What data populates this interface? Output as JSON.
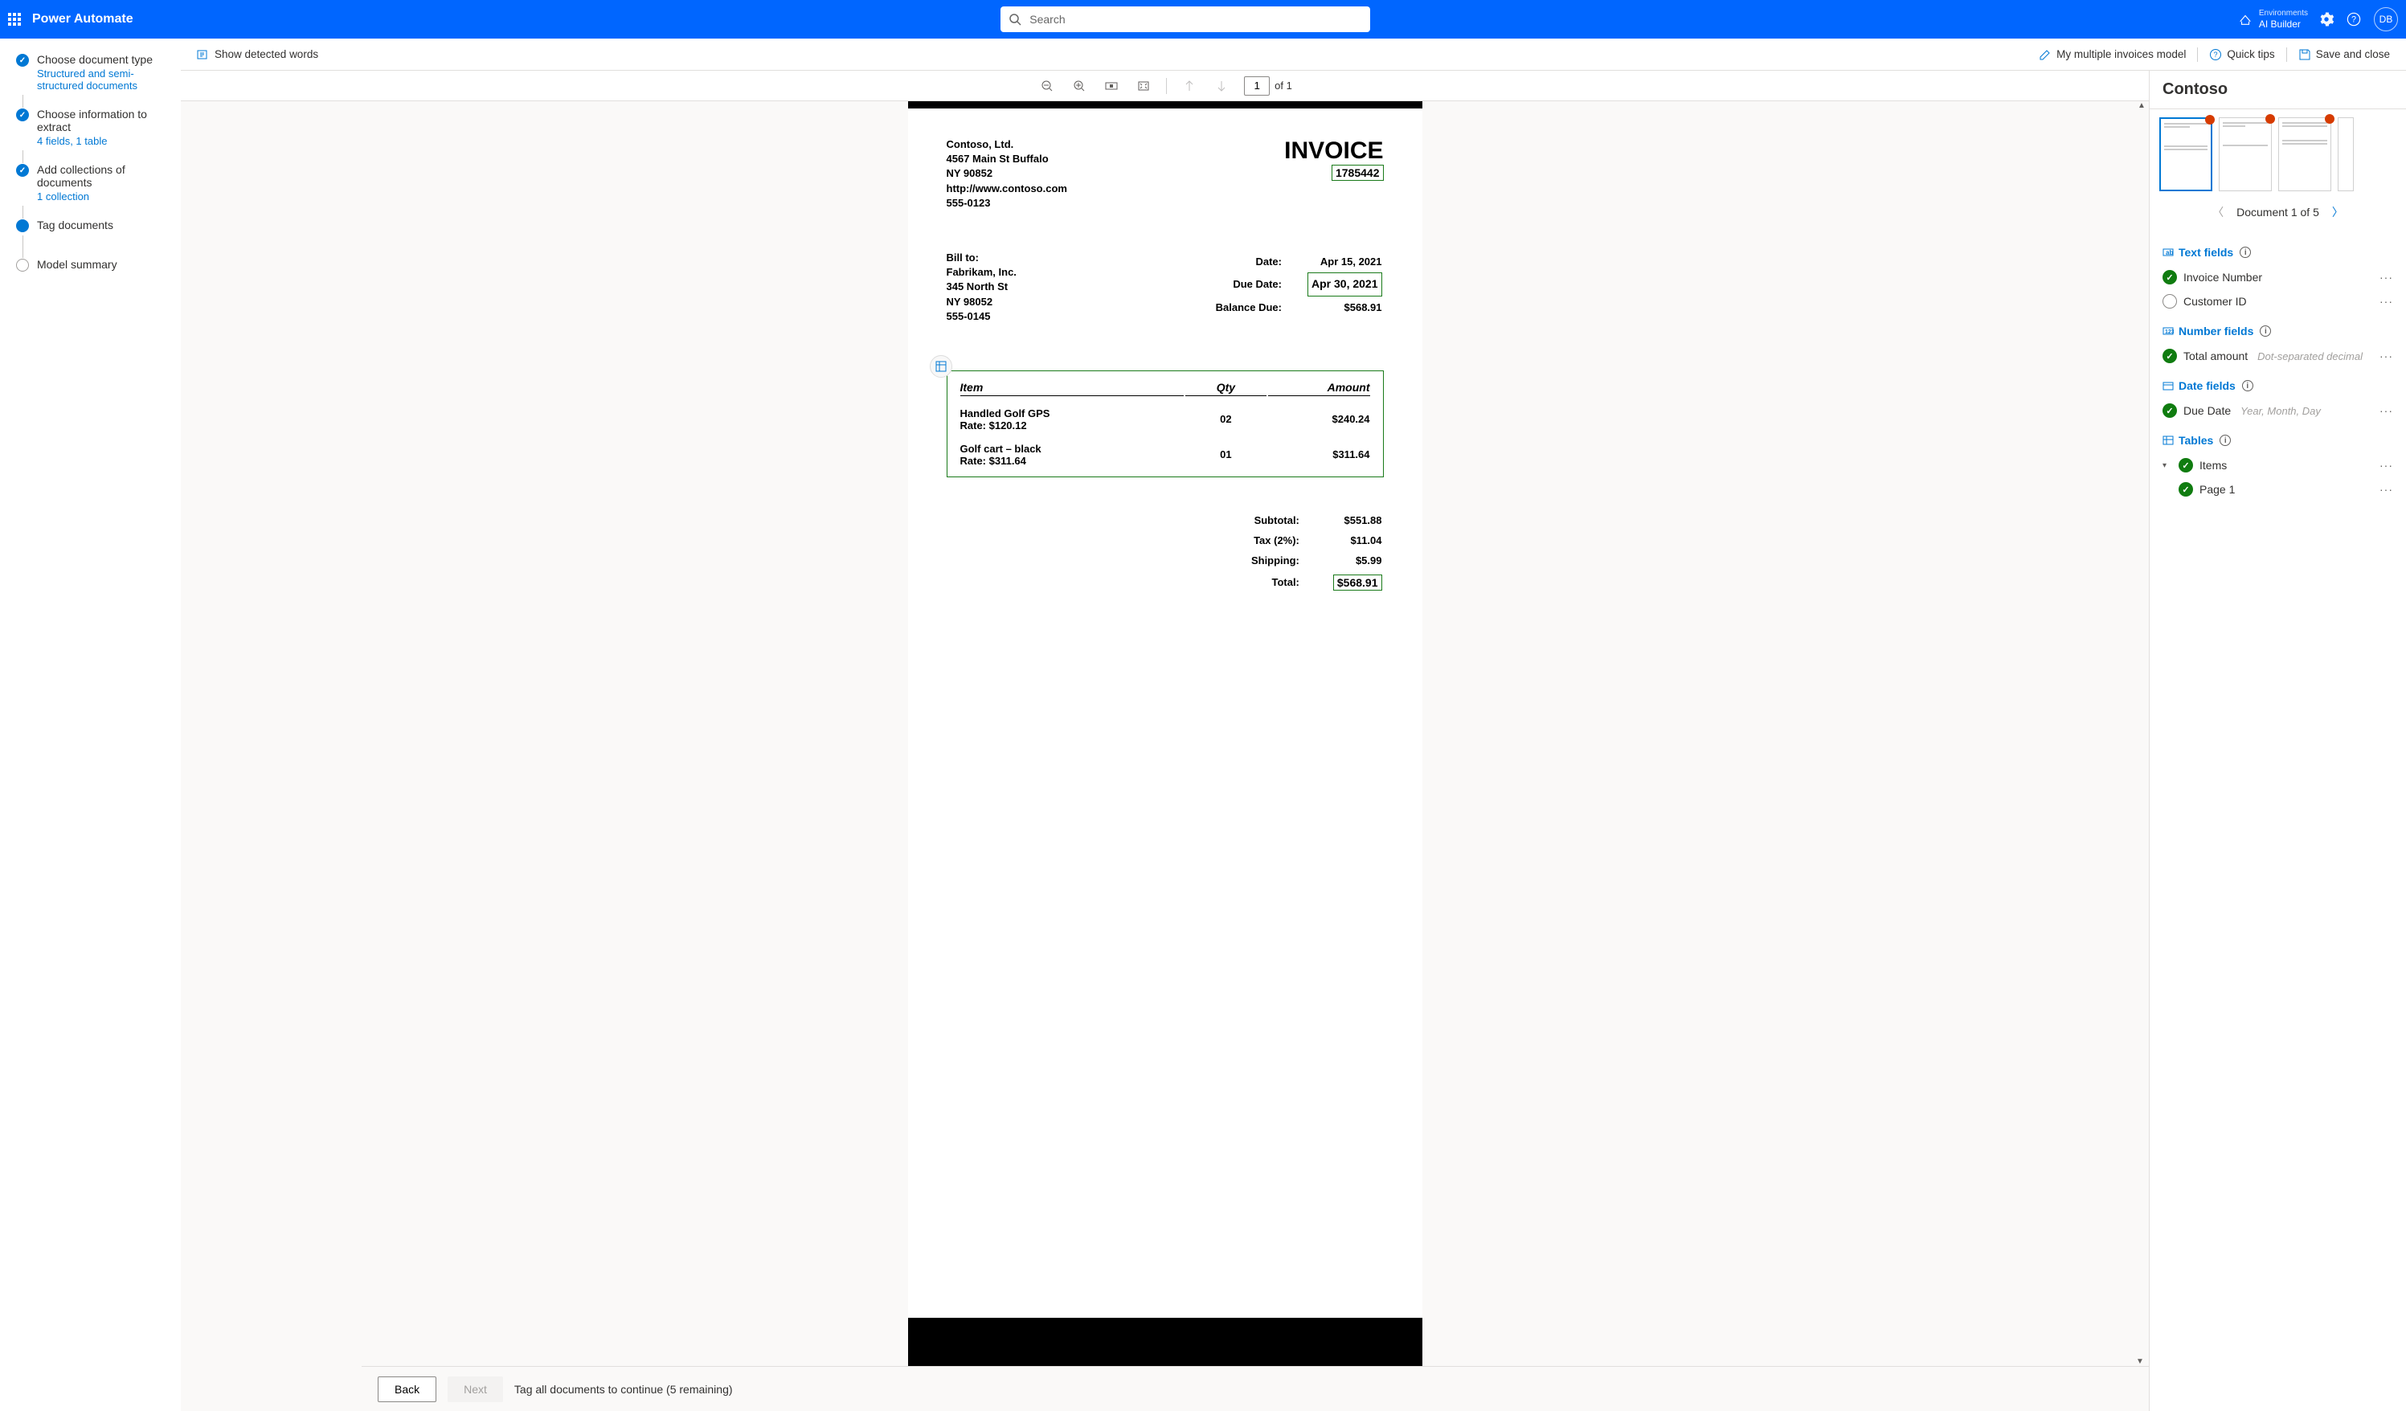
{
  "header": {
    "brand": "Power Automate",
    "search_placeholder": "Search",
    "env_label": "Environments",
    "env_name": "AI Builder",
    "avatar": "DB"
  },
  "cmdbar": {
    "show_words": "Show detected words",
    "model_name": "My multiple invoices model",
    "quick_tips": "Quick tips",
    "save_close": "Save and close"
  },
  "steps": [
    {
      "title": "Choose document type",
      "sub": "Structured and semi-structured documents",
      "state": "done"
    },
    {
      "title": "Choose information to extract",
      "sub": "4 fields, 1 table",
      "state": "done"
    },
    {
      "title": "Add collections of documents",
      "sub": "1 collection",
      "state": "done"
    },
    {
      "title": "Tag documents",
      "sub": "",
      "state": "active"
    },
    {
      "title": "Model summary",
      "sub": "",
      "state": "pending"
    }
  ],
  "viewer": {
    "page_current": "1",
    "page_total": "of 1"
  },
  "invoice": {
    "company": "Contoso, Ltd.",
    "addr1": "4567 Main St Buffalo",
    "addr2": "NY 90852",
    "url": "http://www.contoso.com",
    "phone": "555-0123",
    "title": "INVOICE",
    "number": "1785442",
    "bill_to_label": "Bill to:",
    "bill_to_name": "Fabrikam, Inc.",
    "bill_to_addr": "345 North St",
    "bill_to_city": "NY 98052",
    "bill_to_phone": "555-0145",
    "date_label": "Date:",
    "date_val": "Apr 15, 2021",
    "due_label": "Due Date:",
    "due_val": "Apr 30, 2021",
    "bal_label": "Balance Due:",
    "bal_val": "$568.91",
    "col_item": "Item",
    "col_qty": "Qty",
    "col_amt": "Amount",
    "rows": [
      {
        "name": "Handled Golf GPS",
        "rate": "Rate: $120.12",
        "qty": "02",
        "amount": "$240.24"
      },
      {
        "name": "Golf cart – black",
        "rate": "Rate: $311.64",
        "qty": "01",
        "amount": "$311.64"
      }
    ],
    "sub_label": "Subtotal:",
    "sub_val": "$551.88",
    "tax_label": "Tax (2%):",
    "tax_val": "$11.04",
    "ship_label": "Shipping:",
    "ship_val": "$5.99",
    "tot_label": "Total:",
    "tot_val": "$568.91"
  },
  "rightpanel": {
    "collection": "Contoso",
    "doc_nav": "Document 1 of 5",
    "sections": {
      "text": "Text fields",
      "number": "Number fields",
      "date": "Date fields",
      "tables": "Tables"
    },
    "fields": {
      "invoice_number": "Invoice Number",
      "customer_id": "Customer ID",
      "total_amount": "Total amount",
      "total_hint": "Dot-separated decimal",
      "due_date": "Due Date",
      "due_hint": "Year, Month, Day",
      "items": "Items",
      "page1": "Page 1"
    }
  },
  "footer": {
    "back": "Back",
    "next": "Next",
    "hint": "Tag all documents to continue (5 remaining)"
  }
}
